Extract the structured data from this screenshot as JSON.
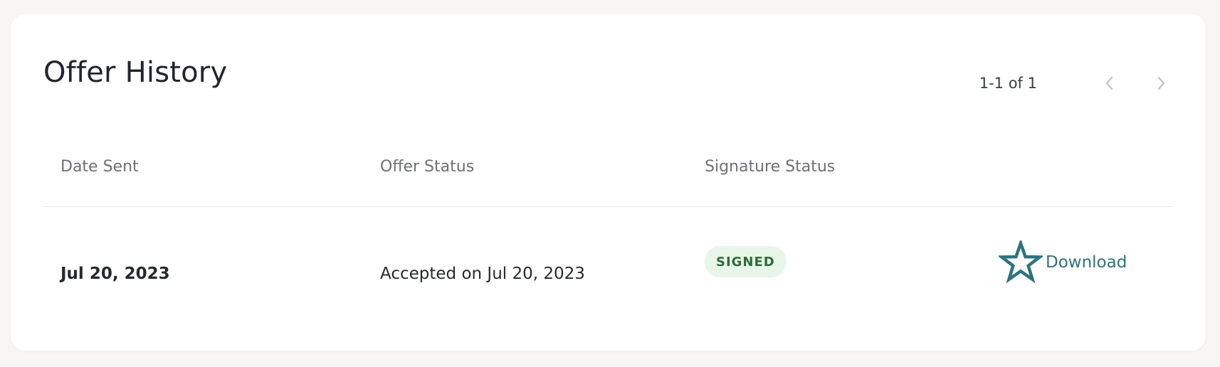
{
  "card": {
    "title": "Offer History",
    "pagination": {
      "range_text": "1-1 of 1",
      "prev_icon": "chevron-left-icon",
      "next_icon": "chevron-right-icon"
    },
    "table": {
      "columns": [
        "Date Sent",
        "Offer Status",
        "Signature Status"
      ],
      "rows": [
        {
          "date_sent": "Jul 20, 2023",
          "offer_status": "Accepted on Jul 20, 2023",
          "signature_status": "SIGNED",
          "action_label": "Download",
          "action_icon": "star-icon"
        }
      ]
    }
  },
  "colors": {
    "accent": "#2e7380",
    "badge_bg": "#e8f5e9",
    "badge_text": "#2f6b3a"
  }
}
